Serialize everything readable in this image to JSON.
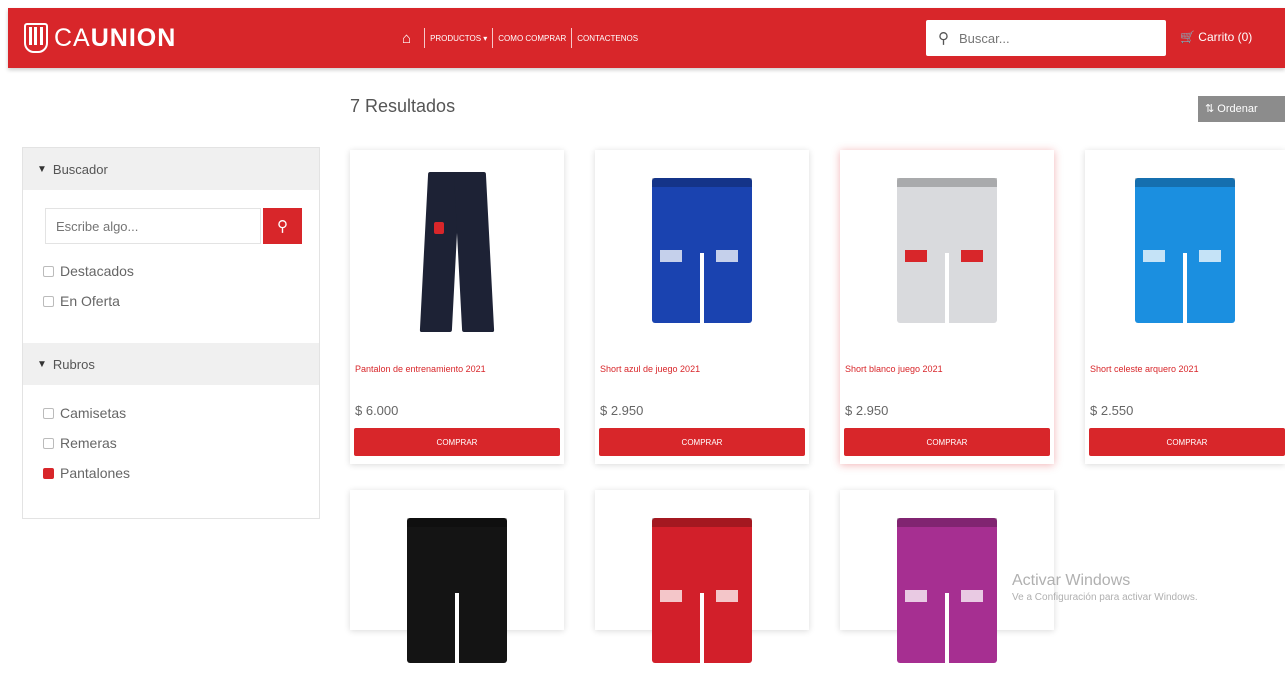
{
  "header": {
    "brand_prefix": "CA",
    "brand_bold": "UNION",
    "home_icon": "home-icon",
    "nav": [
      "PRODUCTOS ▾",
      "COMO COMPRAR",
      "CONTACTENOS"
    ],
    "search_placeholder": "Buscar...",
    "cart_label": "Carrito (0)"
  },
  "results_label": "7 Resultados",
  "order_label": "Ordenar",
  "sidebar": {
    "buscador_title": "Buscador",
    "search_placeholder": "Escribe algo...",
    "filters": [
      "Destacados",
      "En Oferta"
    ],
    "rubros_title": "Rubros",
    "rubros": [
      {
        "label": "Camisetas",
        "checked": false
      },
      {
        "label": "Remeras",
        "checked": false
      },
      {
        "label": "Pantalones",
        "checked": true
      }
    ]
  },
  "products": [
    {
      "title": "Pantalon de entrenamiento 2021",
      "price": "$ 6.000",
      "button": "COMPRAR",
      "color": "#1d2235",
      "kind": "pants"
    },
    {
      "title": "Short azul de juego 2021",
      "price": "$ 2.950",
      "button": "COMPRAR",
      "color": "#1a43b0",
      "kind": "shorts"
    },
    {
      "title": "Short blanco juego 2021",
      "price": "$ 2.950",
      "button": "COMPRAR",
      "color": "#d9dadd",
      "kind": "shorts"
    },
    {
      "title": "Short celeste arquero 2021",
      "price": "$ 2.550",
      "button": "COMPRAR",
      "color": "#1b8fe0",
      "kind": "shorts"
    },
    {
      "color": "#141414",
      "kind": "shorts"
    },
    {
      "color": "#d21f2a",
      "kind": "shorts"
    },
    {
      "color": "#a62f91",
      "kind": "shorts"
    }
  ],
  "watermark": {
    "line1": "Activar Windows",
    "line2": "Ve a Configuración para activar Windows."
  },
  "accent_color": "#d8262a"
}
